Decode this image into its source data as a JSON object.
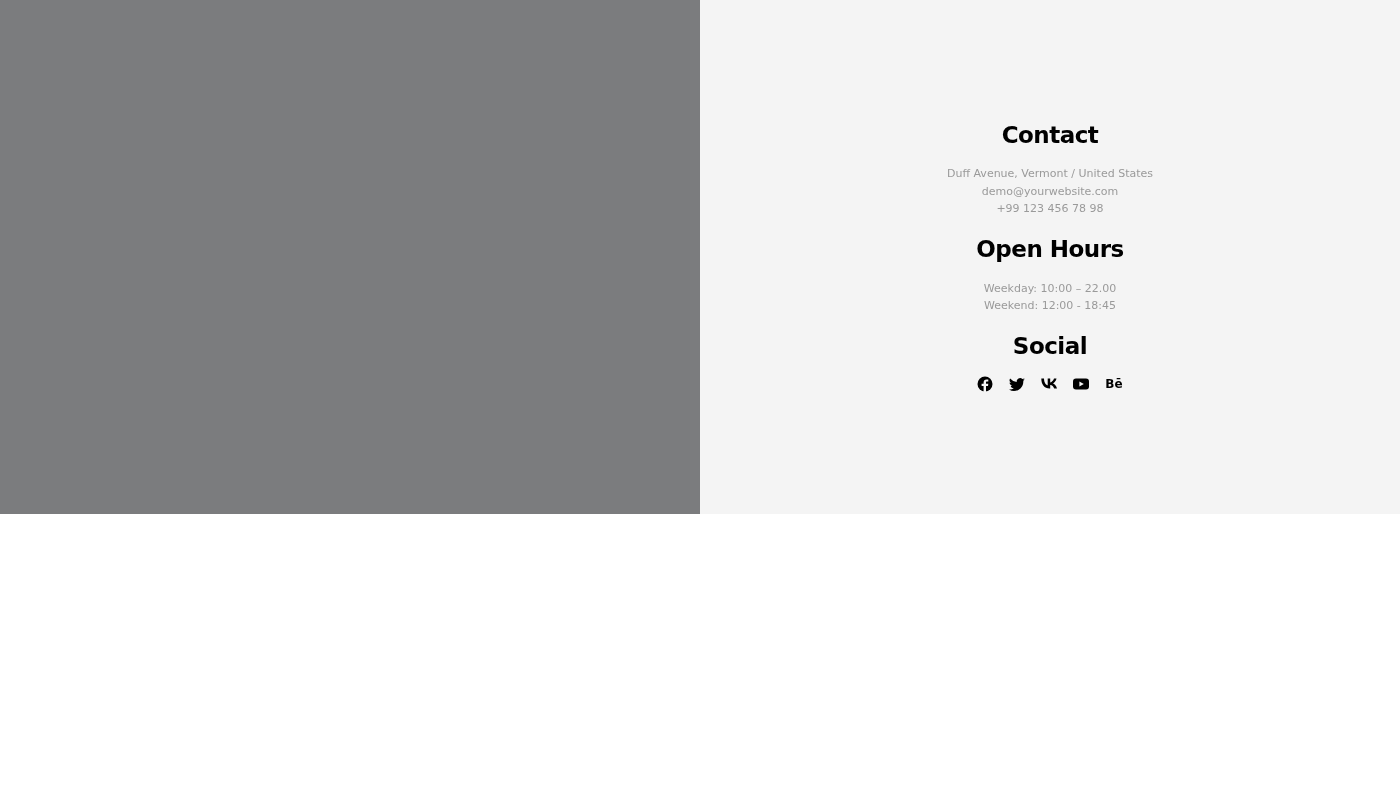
{
  "contact": {
    "title": "Contact",
    "lines": [
      "Duff Avenue, Vermont / United States",
      "demo@yourwebsite.com",
      "+99 123 456 78 98"
    ]
  },
  "open_hours": {
    "title": "Open Hours",
    "lines": [
      "Weekday: 10:00 – 22.00",
      "Weekend: 12:00 - 18:45"
    ]
  },
  "social": {
    "title": "Social",
    "icons": [
      {
        "kind": "facebook"
      },
      {
        "kind": "twitter"
      },
      {
        "kind": "vk"
      },
      {
        "kind": "youtube"
      },
      {
        "kind": "behance",
        "label": "Bē"
      }
    ]
  }
}
